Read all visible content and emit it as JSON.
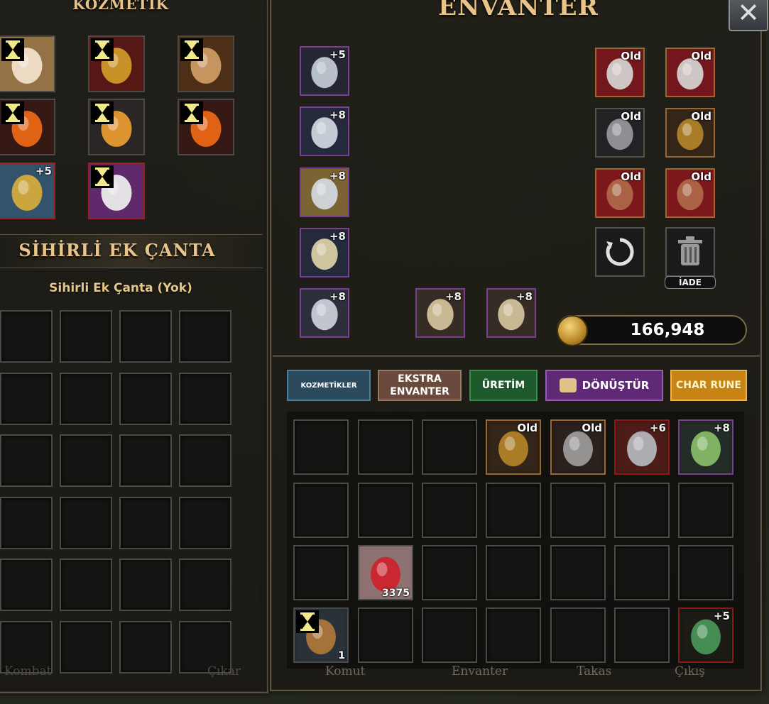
{
  "cosmetic": {
    "title": "KOZMETİK",
    "items": [
      {
        "icon": "fairy-wings-icon",
        "badge": "hourglass",
        "level": ""
      },
      {
        "icon": "gold-armor-icon",
        "badge": "hourglass",
        "level": ""
      },
      {
        "icon": "ornament-icon",
        "badge": "hourglass",
        "level": ""
      },
      {
        "icon": "fire-crown-icon",
        "badge": "hourglass",
        "level": ""
      },
      {
        "icon": "phoenix-wings-icon",
        "badge": "hourglass",
        "level": ""
      },
      {
        "icon": "fire-crown-icon",
        "badge": "hourglass",
        "level": ""
      },
      {
        "icon": "gold-emblem-icon",
        "badge": "",
        "level": "+5"
      },
      {
        "icon": "robe-icon",
        "badge": "hourglass",
        "level": ""
      }
    ]
  },
  "magic_bag": {
    "title": "SİHİRLİ EK ÇANTA",
    "subtitle": "Sihirli Ek Çanta (Yok)"
  },
  "inventory": {
    "title": "ENVANTER",
    "equipment_left": [
      {
        "icon": "helmet-icon",
        "level": "+5"
      },
      {
        "icon": "chest-armor-icon",
        "level": "+8"
      },
      {
        "icon": "leg-armor-icon",
        "level": "+8"
      },
      {
        "icon": "pauldron-icon",
        "level": "+8"
      },
      {
        "icon": "boots-icon",
        "level": "+8"
      }
    ],
    "weapons": [
      {
        "icon": "curved-dagger-icon",
        "level": "+8"
      },
      {
        "icon": "curved-dagger-icon",
        "level": "+8"
      }
    ],
    "accessories": [
      {
        "icon": "earring-icon",
        "tag": "Old"
      },
      {
        "icon": "earring-icon",
        "tag": "Old"
      },
      {
        "icon": "necklace-icon",
        "tag": "Old"
      },
      {
        "icon": "belt-icon",
        "tag": "Old"
      },
      {
        "icon": "ring-icon",
        "tag": "Old"
      },
      {
        "icon": "ring-icon",
        "tag": "Old"
      }
    ],
    "refresh_icon": "refresh-icon",
    "trash_icon": "trash-icon",
    "trash_label": "İADE",
    "gold": "166,948",
    "tabs": {
      "cosmetics": "KOZMETİKLER",
      "extra_line1": "EKSTRA",
      "extra_line2": "ENVANTER",
      "craft": "ÜRETİM",
      "transform": "DÖNÜŞTÜR",
      "rune": "CHAR RUNE"
    },
    "grid": [
      {
        "row": 0,
        "col": 3,
        "icon": "belt-icon",
        "tag": "Old",
        "style": "orange"
      },
      {
        "row": 0,
        "col": 4,
        "icon": "skull-belt-icon",
        "tag": "Old",
        "style": "orange"
      },
      {
        "row": 0,
        "col": 5,
        "icon": "knife-icon",
        "tag": "+6",
        "style": "red"
      },
      {
        "row": 0,
        "col": 6,
        "icon": "leaf-blade-icon",
        "tag": "+8",
        "style": "purple"
      },
      {
        "row": 2,
        "col": 1,
        "icon": "potion-icon",
        "count": "3375",
        "style": "plain"
      },
      {
        "row": 3,
        "col": 0,
        "icon": "magnifier-icon",
        "count": "1",
        "badge": "hourglass",
        "style": "plain"
      },
      {
        "row": 3,
        "col": 6,
        "icon": "green-sword-icon",
        "tag": "+5",
        "style": "red"
      }
    ]
  },
  "footer": {
    "left": "Kombat",
    "left2": "Çıkar",
    "komut": "Komut",
    "envanter": "Envanter",
    "takas": "Takas",
    "cikis": "Çıkış"
  },
  "colors": {
    "gold_text": "#e8c488",
    "tab_cosmetics": "#2c4a5d",
    "tab_extra": "#6a4a3c",
    "tab_craft": "#1e5a2b",
    "tab_transform": "#5e2a76",
    "tab_rune": "#c78414"
  }
}
